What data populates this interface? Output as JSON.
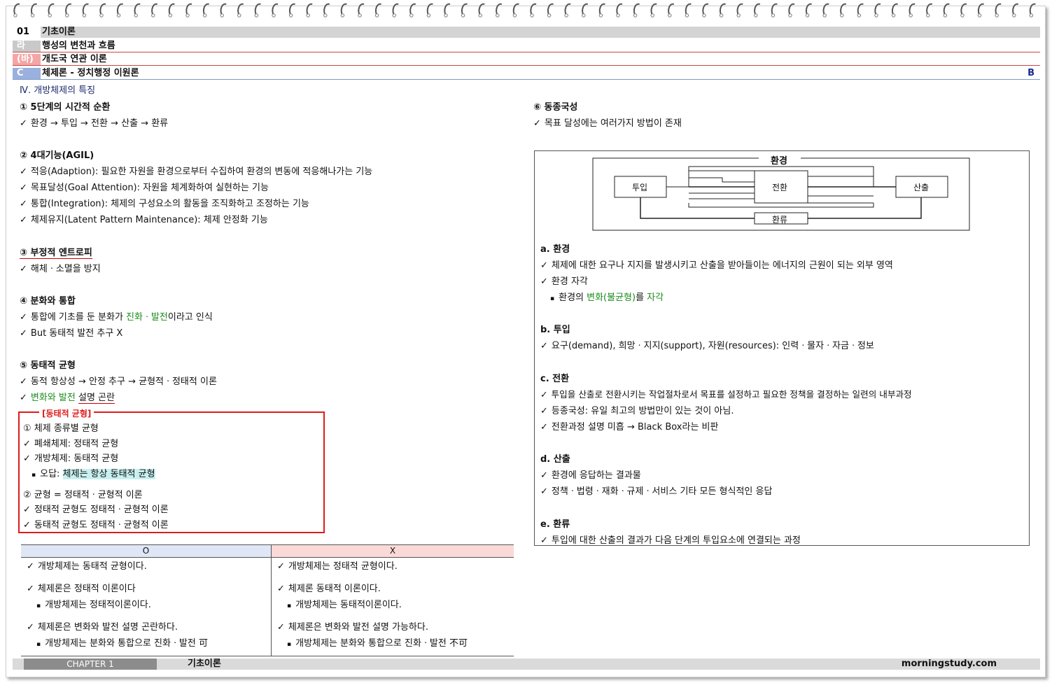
{
  "header": {
    "rows": [
      {
        "no": "01",
        "title": "기초이론"
      },
      {
        "no": "라",
        "title": "행성의 변천과 흐름"
      },
      {
        "no": "(바)",
        "title": "개도국 연관 이론"
      },
      {
        "no": "C",
        "title": "체제론 - 정치행정 이원론",
        "grade": "B"
      }
    ]
  },
  "section_title": "Ⅳ. 개방체제의 특징",
  "left": {
    "s1": {
      "title": "① 5단계의 시간적 순환",
      "items": [
        "환경 → 투입 → 전환 → 산출 → 환류"
      ]
    },
    "s2": {
      "title": "② 4대기능(AGIL)",
      "items": [
        "적응(Adaption): 필요한 자원을 환경으로부터 수집하여 환경의 변동에 적응해나가는 기능",
        "목표달성(Goal Attention): 자원을 체계화하여 실현하는 기능",
        "통합(Integration): 체제의 구성요소의 활동을 조직화하고 조정하는 기능",
        "체제유지(Latent Pattern Maintenance): 체제 안정화 기능"
      ]
    },
    "s3": {
      "title": "③ 부정적 엔트로피",
      "items": [
        "해체ㆍ소멸을 방지"
      ]
    },
    "s4": {
      "title": "④ 분화와 통합",
      "item1_pre": "통합에 기초를 둔 분화가 ",
      "item1_green": "진화ㆍ발전",
      "item1_post": "이라고 인식",
      "item2": "But 동태적 발전 추구 X"
    },
    "s5": {
      "title": "⑤ 동태적 균형",
      "item1": "동적 항상성 → 안정 추구 → 균형적ㆍ정태적 이론",
      "item2_green": "변화와 발전",
      "item2_red": "설명 곤란"
    },
    "box": {
      "title": "[동태적 균형]",
      "sub1": "① 체제 종류별 균형",
      "c1": "폐쇄체제: 정태적 균형",
      "c2": "개방체제: 동태적 균형",
      "b1_pre": "오답: ",
      "b1_hl": "체제는 항상 동태적 균형",
      "sub2": "② 균형 = 정태적ㆍ균형적 이론",
      "c3": "정태적 균형도 정태적ㆍ균형적 이론",
      "c4": "동태적 균형도 정태적ㆍ균형적 이론"
    },
    "table": {
      "col_o": "O",
      "col_x": "X",
      "o": {
        "r1": "개방체제는 동태적 균형이다.",
        "r2": "체제론은 정태적 이론이다",
        "r2b": "개방체제는 정태적이론이다.",
        "r3": "체제론은 변화와 발전 설명 곤란하다.",
        "r3b": "개방체제는 분화와 통합으로 진화ㆍ발전 可"
      },
      "x": {
        "r1": "개방체제는 정태적 균형이다.",
        "r2": "체제론 동태적 이론이다.",
        "r2b": "개방체제는 동태적이론이다.",
        "r3": "체제론은 변화와 발전 설명 가능하다.",
        "r3b": "개방체제는 분화와 통합으로 진화ㆍ발전 不可"
      }
    }
  },
  "right": {
    "s6": {
      "title": "⑥ 동종국성",
      "items": [
        "목표 달성에는 여러가지 방법이 존재"
      ]
    },
    "diagram": {
      "env": "환경",
      "input": "투입",
      "conversion": "전환",
      "output": "산출",
      "feedback": "환류"
    },
    "a": {
      "title": "a. 환경",
      "c1": "체제에 대한 요구나 지지를 발생시키고 산출을 받아들이는 에너지의 근원이 되는 외부 영역",
      "c2": "환경 자각",
      "b1_pre": "환경의 ",
      "b1_green": "변화(불균형)",
      "b1_mid": "를 ",
      "b1_green2": "자각"
    },
    "b": {
      "title": "b. 투입",
      "c1": "요구(demand), 희망ㆍ지지(support), 자원(resources): 인력ㆍ물자ㆍ자금ㆍ정보"
    },
    "c": {
      "title": "c. 전환",
      "c1": "투입을 산출로 전환시키는 작업절차로서 목표를 설정하고 필요한 정책을 결정하는 일련의 내부과정",
      "c2": "등종국성: 유일 최고의 방법만이 있는 것이 아님.",
      "c3": "전환과정 설명 미흡 → Black Box라는 비판"
    },
    "d": {
      "title": "d. 산출",
      "c1": "환경에 응답하는 결과물",
      "c2": "정책ㆍ법령ㆍ재화ㆍ규제ㆍ서비스 기타 모든 형식적인 응답"
    },
    "e": {
      "title": "e. 환류",
      "c1": "투입에 대한 산출의 결과가 다음 단계의 투입요소에 연결되는 과정"
    }
  },
  "footer": {
    "chapter": "CHAPTER 1",
    "title": "기초이론",
    "site": "morningstudy.com"
  },
  "check": "✓",
  "bullet": "▪"
}
